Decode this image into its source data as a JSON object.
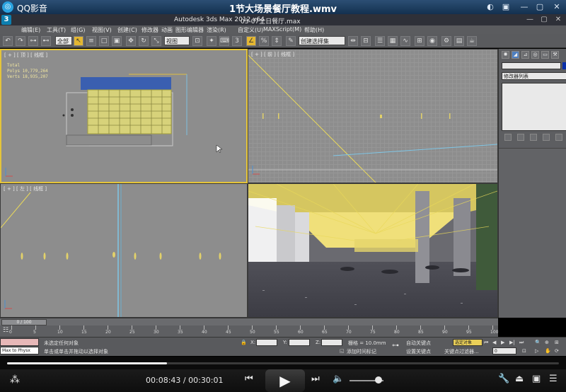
{
  "player": {
    "app_name": "QQ影音",
    "file_name": "1节大场景餐厅教程.wmv",
    "window_buttons": [
      "◐",
      "▣",
      "—",
      "▢",
      "✕"
    ],
    "time_current": "00:08:43",
    "time_total": "00:30:01",
    "time_separator": " / ",
    "progress": 0.29,
    "volume": 0.85
  },
  "max": {
    "app_title": "Autodesk 3ds Max  2012 x64",
    "file_title": "03-07全日餐厅.max",
    "menu": [
      "编辑(E)",
      "工具(T)",
      "组(G)",
      "视图(V)",
      "创建(C)",
      "修改器",
      "动画",
      "图形编辑器",
      "渲染(R)",
      "自定义(U)",
      "MAXScript(M)",
      "帮助(H)"
    ],
    "toolbar": {
      "filter_dropdown": "全部",
      "view_dropdown": "视图",
      "selection_set": "创建选择集"
    },
    "viewports": {
      "top": {
        "label": "[ + ] [ 顶 ] [ 线框 ]",
        "stats": [
          "Total",
          "Polys  10,779,264",
          "Verts  18,935,207"
        ]
      },
      "front": {
        "label": "[ + ] [ 前 ] [ 线框 ]"
      },
      "left": {
        "label": "[ + ] [ 左 ] [ 线框 ]"
      },
      "perspective": {
        "label": ""
      }
    },
    "command_panel": {
      "modifier_list": "修改器列表"
    },
    "timeline": {
      "slider_label": "0 / 100",
      "ticks": [
        "0",
        "5",
        "10",
        "15",
        "20",
        "25",
        "30",
        "35",
        "40",
        "45",
        "50",
        "55",
        "60",
        "65",
        "70",
        "75",
        "80",
        "85",
        "90",
        "95",
        "100"
      ]
    },
    "status": {
      "max_to_physx": "Max to Physx",
      "selection_status": "未选定任何对象",
      "prompt": "单击或单击并拖动以选择对象",
      "x_label": "X:",
      "y_label": "Y:",
      "z_label": "Z:",
      "grid": "栅格 = 10.0mm",
      "add_time_tag": "添加时间标记",
      "auto_key": "自动关键点",
      "set_key": "设置关键点",
      "selected_object": "选定对象",
      "key_filters": "关键点过滤器...",
      "frame": "0"
    }
  }
}
